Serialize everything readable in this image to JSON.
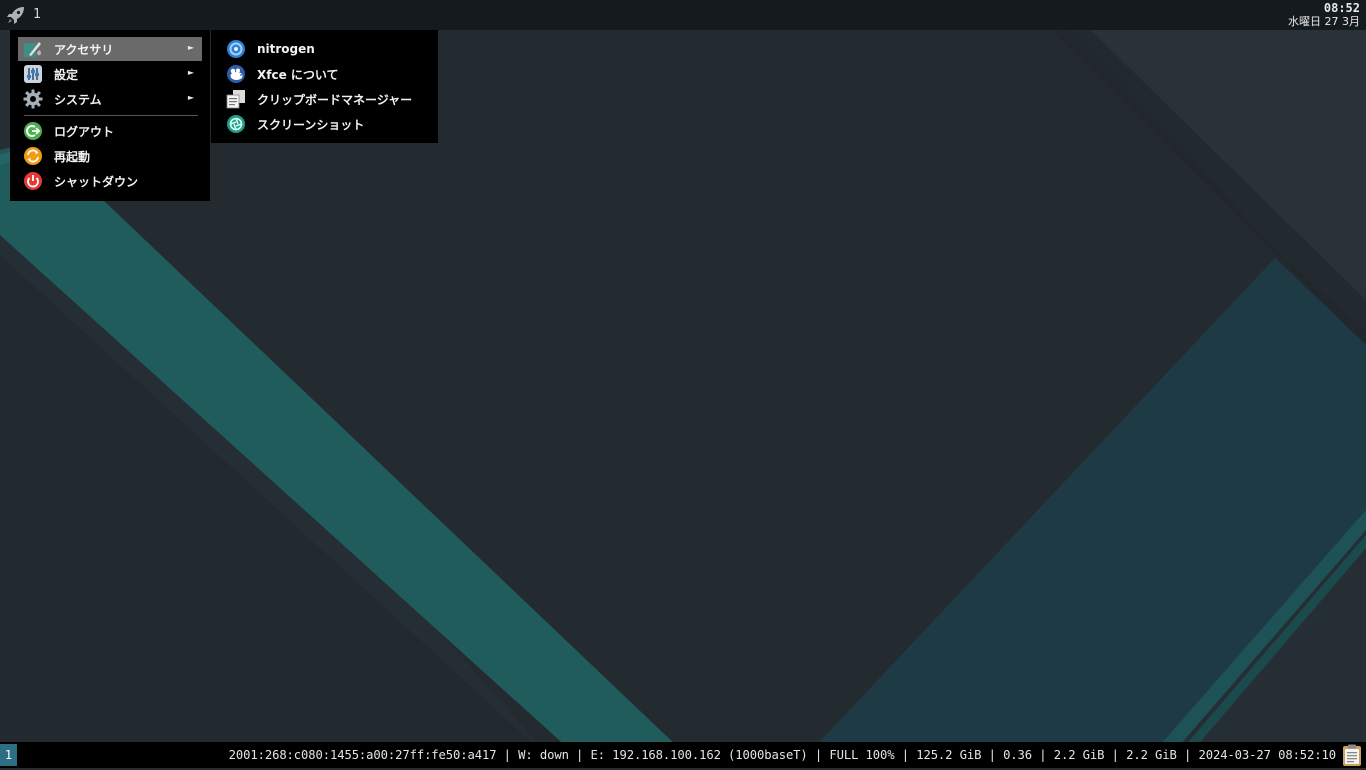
{
  "top_panel": {
    "workspace": "1",
    "clock_time": "08:52",
    "clock_date": "水曜日 27 3月"
  },
  "main_menu": {
    "items": [
      {
        "label": "アクセサリ",
        "icon": "accessories-icon",
        "submenu": true
      },
      {
        "label": "設定",
        "icon": "settings-icon",
        "submenu": true
      },
      {
        "label": "システム",
        "icon": "system-gear-icon",
        "submenu": true
      }
    ],
    "session_items": [
      {
        "label": "ログアウト",
        "icon": "logout-icon"
      },
      {
        "label": "再起動",
        "icon": "restart-icon"
      },
      {
        "label": "シャットダウン",
        "icon": "power-icon"
      }
    ],
    "arrow": "►"
  },
  "sub_menu": {
    "items": [
      {
        "label": "nitrogen",
        "icon": "nitrogen-icon"
      },
      {
        "label": "Xfce について",
        "icon": "xfce-mouse-icon"
      },
      {
        "label": "クリップボードマネージャー",
        "icon": "clipboard-manager-icon"
      },
      {
        "label": "スクリーンショット",
        "icon": "screenshot-aperture-icon"
      }
    ]
  },
  "bottom_bar": {
    "workspace": "1",
    "status_text": "2001:268:c080:1455:a00:27ff:fe50:a417 | W: down | E: 192.168.100.162 (1000baseT) | FULL 100% | 125.2 GiB | 0.36 | 2.2 GiB | 2.2 GiB | 2024-03-27 08:52:10"
  },
  "colors": {
    "wallpaper_dark": "#252d34",
    "wallpaper_teal": "#215c5c",
    "panel": "#151a1e",
    "menu_bg": "#000000",
    "menu_highlight": "#6a6a6a",
    "workspace_indicator": "#2c6f85"
  }
}
